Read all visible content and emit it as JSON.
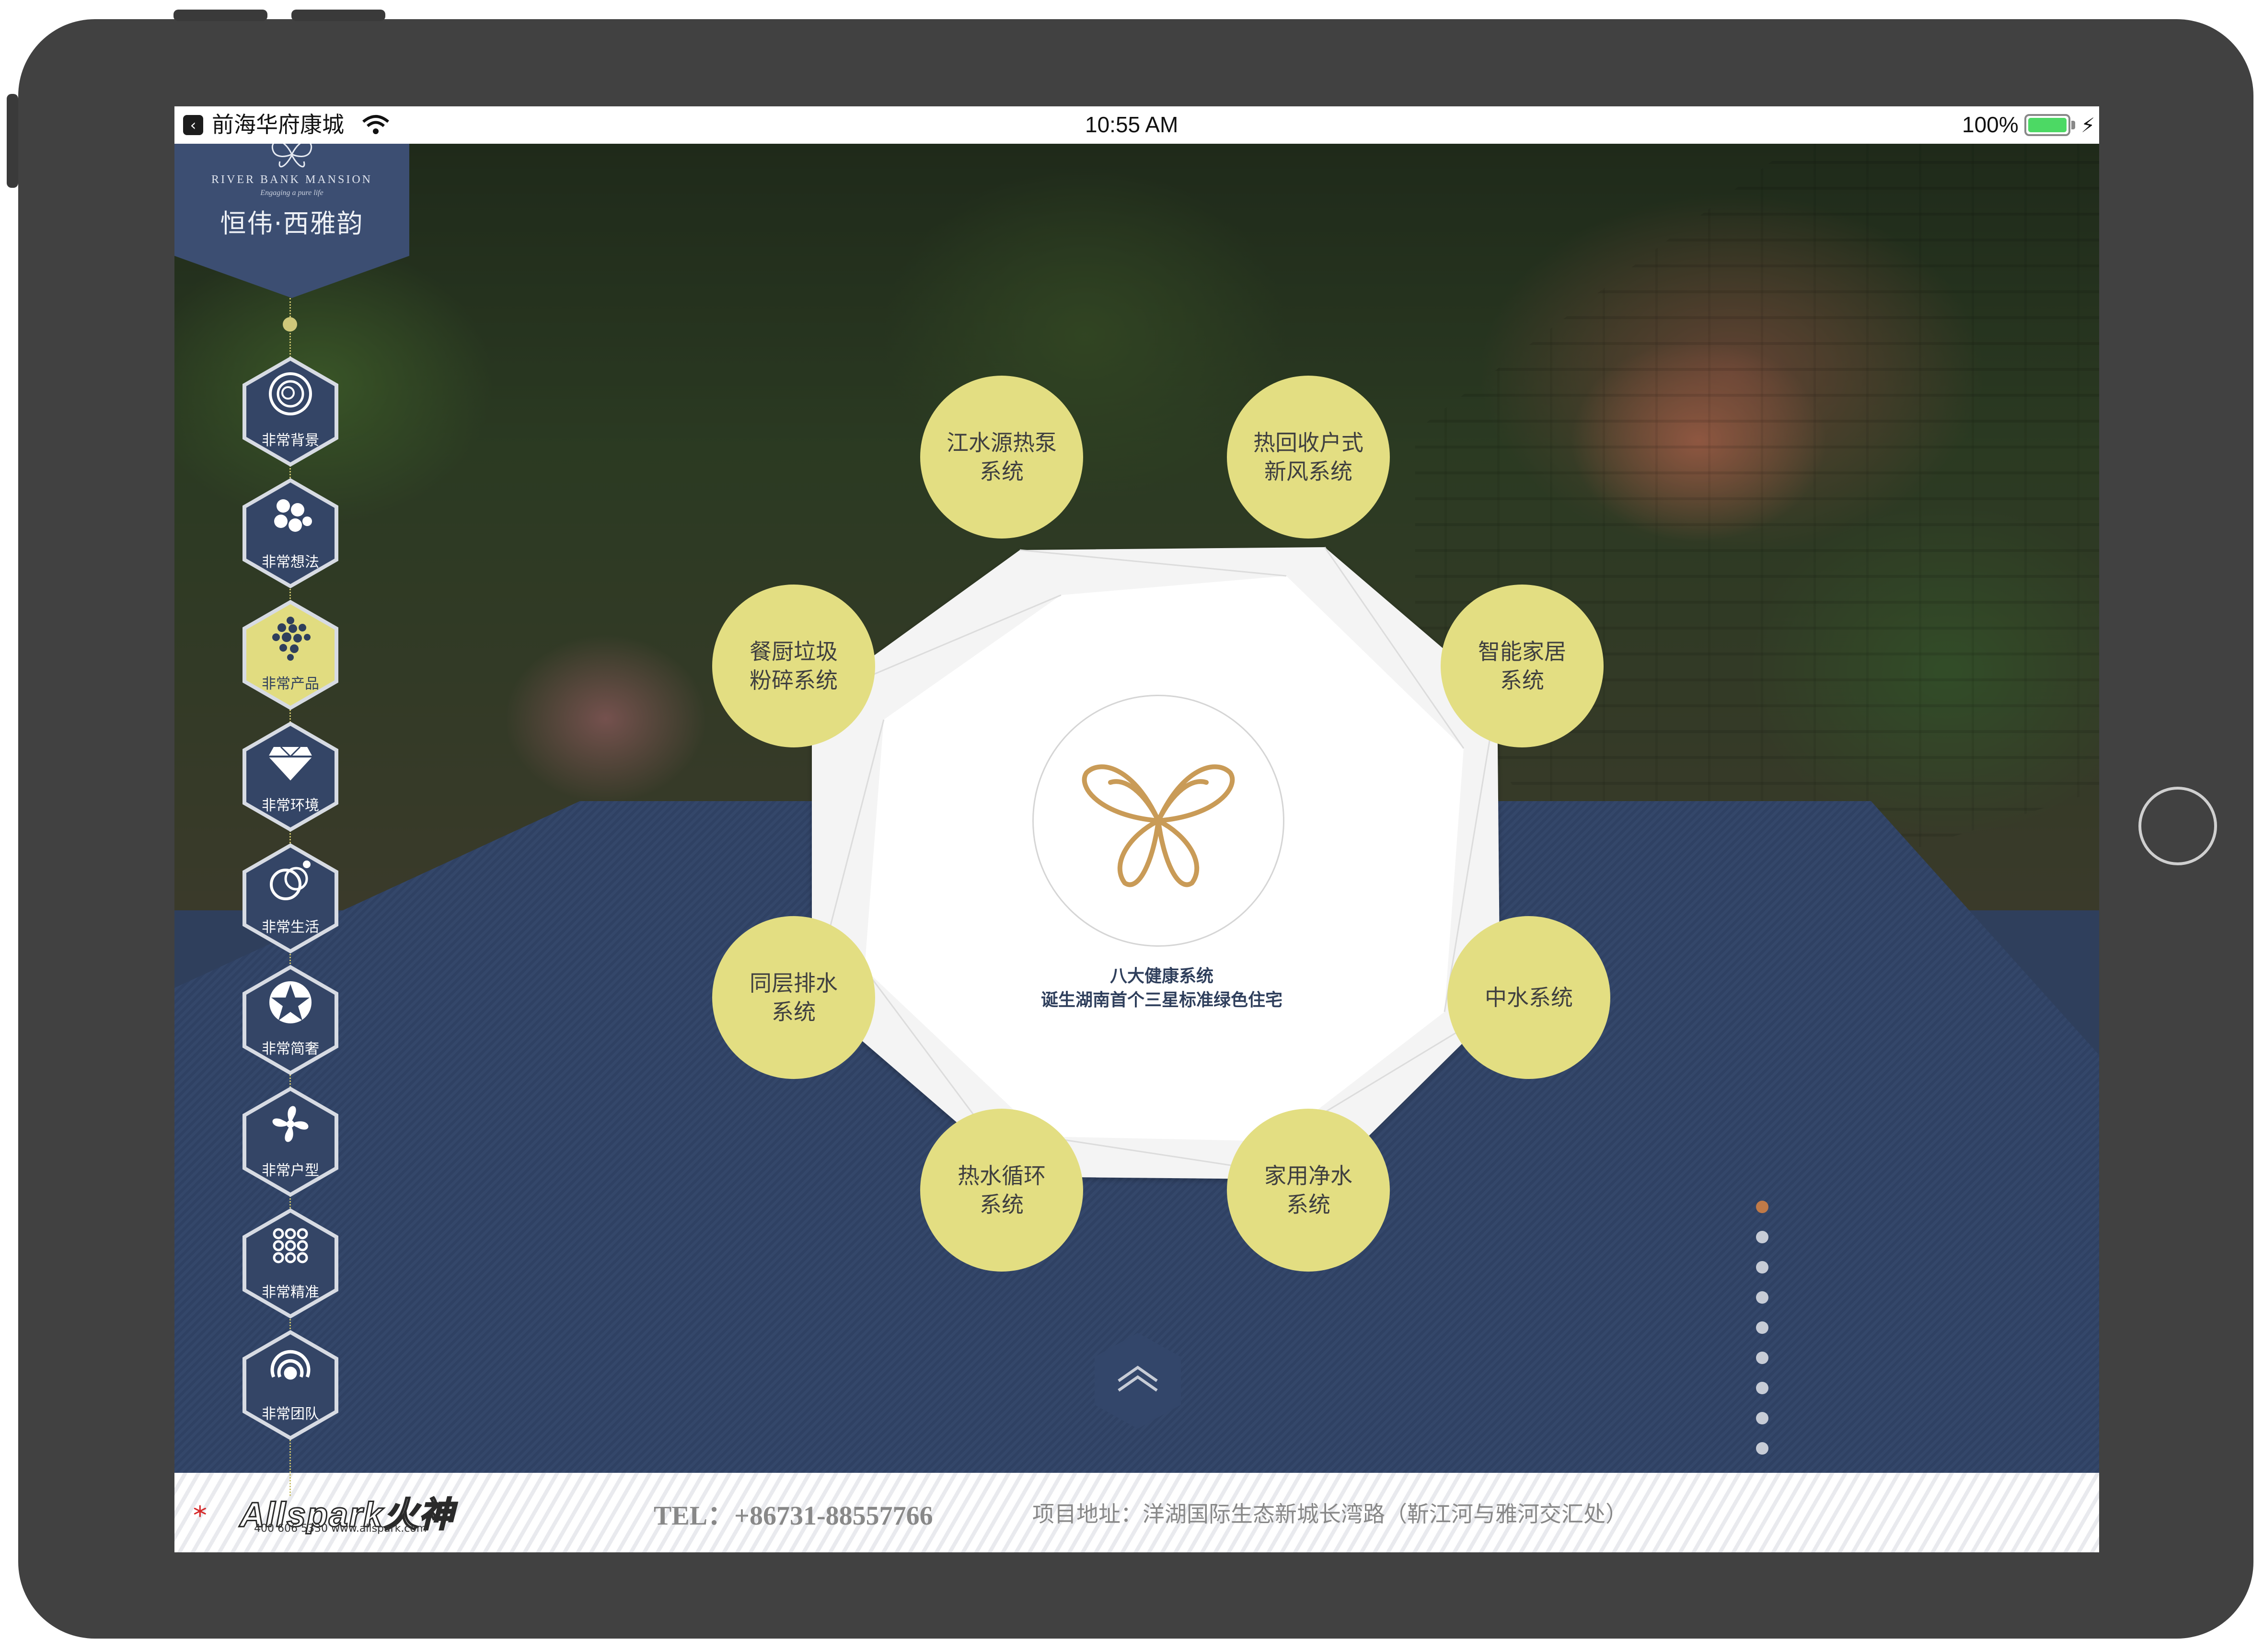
{
  "status_bar": {
    "app_name": "前海华府康城",
    "time": "10:55 AM",
    "battery": "100%",
    "battery_level": 1.0
  },
  "logo": {
    "en": "RIVER BANK MANSION",
    "tagline": "Engaging a pure life",
    "cn": "恒伟·西雅韵"
  },
  "sidebar": {
    "items": [
      {
        "label": "非常背景",
        "icon": "rose-icon"
      },
      {
        "label": "非常想法",
        "icon": "circles-cluster-icon"
      },
      {
        "label": "非常产品",
        "icon": "grape-cluster-icon",
        "active": true
      },
      {
        "label": "非常环境",
        "icon": "diamond-icon"
      },
      {
        "label": "非常生活",
        "icon": "rings-icon"
      },
      {
        "label": "非常简奢",
        "icon": "star-badge-icon"
      },
      {
        "label": "非常户型",
        "icon": "pinwheel-icon"
      },
      {
        "label": "非常精准",
        "icon": "dot-grid-icon"
      },
      {
        "label": "非常团队",
        "icon": "swirl-icon"
      }
    ]
  },
  "main": {
    "center_caption_1": "八大健康系统",
    "center_caption_2": "诞生湖南首个三星标准绿色住宅",
    "systems": [
      "江水源热泵\n系统",
      "热回收户式\n新风系统",
      "智能家居\n系统",
      "中水系统",
      "家用净水\n系统",
      "热水循环\n系统",
      "同层排水\n系统",
      "餐厨垃圾\n粉碎系统"
    ]
  },
  "pager": {
    "count": 9,
    "current": 1
  },
  "footer": {
    "brand": "Allspark火神",
    "brand_sub": "400 606 5330  www.allspark.com",
    "tel": "TEL：+86731-88557766",
    "address": "项目地址：洋湖国际生态新城长湾路（靳江河与雅河交汇处）"
  },
  "colors": {
    "navy": "#2f4163",
    "accent_yellow": "#e3de82",
    "active_dot": "#c07a48"
  }
}
